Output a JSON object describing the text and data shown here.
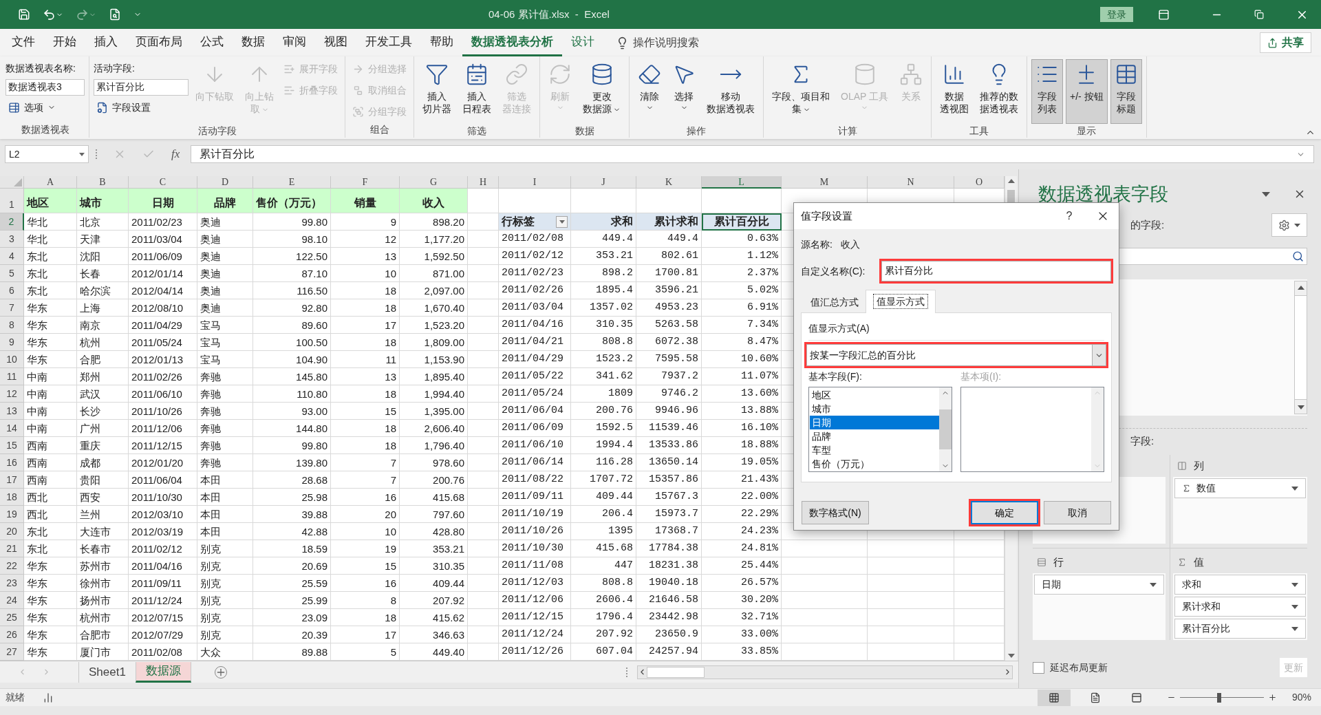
{
  "title_bar": {
    "title": "04-06 累计值.xlsx  -  Excel",
    "sign_in": "登录"
  },
  "menu_tabs": [
    {
      "label": "文件",
      "selected": false,
      "contextual": false
    },
    {
      "label": "开始",
      "selected": false,
      "contextual": false
    },
    {
      "label": "插入",
      "selected": false,
      "contextual": false
    },
    {
      "label": "页面布局",
      "selected": false,
      "contextual": false
    },
    {
      "label": "公式",
      "selected": false,
      "contextual": false
    },
    {
      "label": "数据",
      "selected": false,
      "contextual": false
    },
    {
      "label": "审阅",
      "selected": false,
      "contextual": false
    },
    {
      "label": "视图",
      "selected": false,
      "contextual": false
    },
    {
      "label": "开发工具",
      "selected": false,
      "contextual": false
    },
    {
      "label": "帮助",
      "selected": false,
      "contextual": false
    },
    {
      "label": "数据透视表分析",
      "selected": true,
      "contextual": true
    },
    {
      "label": "设计",
      "selected": false,
      "contextual": true
    }
  ],
  "tell_me": "操作说明搜索",
  "share": "共享",
  "ribbon": [
    {
      "label": "数据透视表",
      "items": [
        {
          "kind": "caption",
          "label": "数据透视表名称:"
        },
        {
          "kind": "field",
          "value": "数据透视表3"
        },
        {
          "kind": "small",
          "label": "选项",
          "dropdown": true,
          "disabled": false
        }
      ]
    },
    {
      "label": "活动字段",
      "items": [
        {
          "kind": "caption",
          "label": "活动字段:"
        },
        {
          "kind": "field",
          "value": "累计百分比"
        },
        {
          "kind": "small",
          "label": "字段设置",
          "dropdown": false,
          "disabled": false
        },
        {
          "kind": "large",
          "lines": [
            "向下钻取"
          ],
          "dropdown": false,
          "disabled": true
        },
        {
          "kind": "large",
          "lines": [
            "向上钻",
            "取"
          ],
          "dropdown": true,
          "disabled": true
        },
        {
          "kind": "small",
          "label": "展开字段",
          "dropdown": false,
          "disabled": true
        },
        {
          "kind": "small",
          "label": "折叠字段",
          "dropdown": false,
          "disabled": true
        }
      ]
    },
    {
      "label": "组合",
      "items": [
        {
          "kind": "small",
          "label": "分组选择",
          "dropdown": false,
          "disabled": true
        },
        {
          "kind": "small",
          "label": "取消组合",
          "dropdown": false,
          "disabled": true
        },
        {
          "kind": "small",
          "label": "分组字段",
          "dropdown": false,
          "disabled": true
        }
      ]
    },
    {
      "label": "筛选",
      "items": [
        {
          "kind": "large",
          "lines": [
            "插入",
            "切片器"
          ],
          "dropdown": false,
          "disabled": false
        },
        {
          "kind": "large",
          "lines": [
            "插入",
            "日程表"
          ],
          "dropdown": false,
          "disabled": false
        },
        {
          "kind": "large",
          "lines": [
            "筛选",
            "器连接"
          ],
          "dropdown": false,
          "disabled": true
        }
      ]
    },
    {
      "label": "数据",
      "items": [
        {
          "kind": "large",
          "lines": [
            "刷新"
          ],
          "dropdown": true,
          "disabled": true
        },
        {
          "kind": "large",
          "lines": [
            "更改",
            "数据源"
          ],
          "dropdown": true,
          "disabled": false
        }
      ]
    },
    {
      "label": "操作",
      "items": [
        {
          "kind": "large",
          "lines": [
            "清除"
          ],
          "dropdown": true,
          "disabled": false
        },
        {
          "kind": "large",
          "lines": [
            "选择"
          ],
          "dropdown": true,
          "disabled": false
        },
        {
          "kind": "large",
          "lines": [
            "移动",
            "数据透视表"
          ],
          "dropdown": false,
          "disabled": false
        }
      ]
    },
    {
      "label": "计算",
      "items": [
        {
          "kind": "large",
          "lines": [
            "字段、项目和",
            "集"
          ],
          "dropdown": true,
          "disabled": false
        },
        {
          "kind": "large",
          "lines": [
            "OLAP 工具"
          ],
          "dropdown": true,
          "disabled": true
        },
        {
          "kind": "large",
          "lines": [
            "关系"
          ],
          "dropdown": false,
          "disabled": true
        }
      ]
    },
    {
      "label": "工具",
      "items": [
        {
          "kind": "large",
          "lines": [
            "数据",
            "透视图"
          ],
          "dropdown": false,
          "disabled": false
        },
        {
          "kind": "large",
          "lines": [
            "推荐的数",
            "据透视表"
          ],
          "dropdown": false,
          "disabled": false
        }
      ]
    },
    {
      "label": "显示",
      "items": [
        {
          "kind": "large",
          "lines": [
            "字段",
            "列表"
          ],
          "dropdown": false,
          "disabled": false,
          "pressed": true
        },
        {
          "kind": "large",
          "lines": [
            "+/- 按钮"
          ],
          "dropdown": false,
          "disabled": false,
          "pressed": true
        },
        {
          "kind": "large",
          "lines": [
            "字段",
            "标题"
          ],
          "dropdown": false,
          "disabled": false,
          "pressed": true
        }
      ]
    }
  ],
  "formula_bar": {
    "name_box": "L2",
    "function_label": "fx",
    "content": "累计百分比"
  },
  "columns": [
    {
      "label": "A",
      "selected": false
    },
    {
      "label": "B",
      "selected": false
    },
    {
      "label": "C",
      "selected": false
    },
    {
      "label": "D",
      "selected": false
    },
    {
      "label": "E",
      "selected": false
    },
    {
      "label": "F",
      "selected": false
    },
    {
      "label": "G",
      "selected": false
    },
    {
      "label": "H",
      "selected": false
    },
    {
      "label": "I",
      "selected": false
    },
    {
      "label": "J",
      "selected": false
    },
    {
      "label": "K",
      "selected": false
    },
    {
      "label": "L",
      "selected": true
    },
    {
      "label": "M",
      "selected": false
    },
    {
      "label": "N",
      "selected": false
    },
    {
      "label": "O",
      "selected": false
    }
  ],
  "row_numbers": [
    {
      "label": "1",
      "selected": false
    },
    {
      "label": "2",
      "selected": true
    },
    {
      "label": "3",
      "selected": false
    },
    {
      "label": "4",
      "selected": false
    },
    {
      "label": "5",
      "selected": false
    },
    {
      "label": "6",
      "selected": false
    },
    {
      "label": "7",
      "selected": false
    },
    {
      "label": "8",
      "selected": false
    },
    {
      "label": "9",
      "selected": false
    },
    {
      "label": "10",
      "selected": false
    },
    {
      "label": "11",
      "selected": false
    },
    {
      "label": "12",
      "selected": false
    },
    {
      "label": "13",
      "selected": false
    },
    {
      "label": "14",
      "selected": false
    },
    {
      "label": "15",
      "selected": false
    },
    {
      "label": "16",
      "selected": false
    },
    {
      "label": "17",
      "selected": false
    },
    {
      "label": "18",
      "selected": false
    },
    {
      "label": "19",
      "selected": false
    },
    {
      "label": "20",
      "selected": false
    },
    {
      "label": "21",
      "selected": false
    },
    {
      "label": "22",
      "selected": false
    },
    {
      "label": "23",
      "selected": false
    },
    {
      "label": "24",
      "selected": false
    },
    {
      "label": "25",
      "selected": false
    },
    {
      "label": "26",
      "selected": false
    },
    {
      "label": "27",
      "selected": false
    }
  ],
  "source_table": {
    "header": [
      "地区",
      "城市",
      "日期",
      "品牌",
      "售价（万元）",
      "销量",
      "收入"
    ],
    "rows": [
      [
        "华北",
        "北京",
        "2011/02/23",
        "奥迪",
        "99.80",
        "9",
        "898.20"
      ],
      [
        "华北",
        "天津",
        "2011/03/04",
        "奥迪",
        "98.10",
        "12",
        "1,177.20"
      ],
      [
        "东北",
        "沈阳",
        "2011/06/09",
        "奥迪",
        "122.50",
        "13",
        "1,592.50"
      ],
      [
        "东北",
        "长春",
        "2012/01/14",
        "奥迪",
        "87.10",
        "10",
        "871.00"
      ],
      [
        "东北",
        "哈尔滨",
        "2012/04/14",
        "奥迪",
        "116.50",
        "18",
        "2,097.00"
      ],
      [
        "华东",
        "上海",
        "2012/08/10",
        "奥迪",
        "92.80",
        "18",
        "1,670.40"
      ],
      [
        "华东",
        "南京",
        "2011/04/29",
        "宝马",
        "89.60",
        "17",
        "1,523.20"
      ],
      [
        "华东",
        "杭州",
        "2011/05/24",
        "宝马",
        "100.50",
        "18",
        "1,809.00"
      ],
      [
        "华东",
        "合肥",
        "2012/01/13",
        "宝马",
        "104.90",
        "11",
        "1,153.90"
      ],
      [
        "中南",
        "郑州",
        "2011/02/26",
        "奔驰",
        "145.80",
        "13",
        "1,895.40"
      ],
      [
        "中南",
        "武汉",
        "2011/06/10",
        "奔驰",
        "110.80",
        "18",
        "1,994.40"
      ],
      [
        "中南",
        "长沙",
        "2011/10/26",
        "奔驰",
        "93.00",
        "15",
        "1,395.00"
      ],
      [
        "中南",
        "广州",
        "2011/12/06",
        "奔驰",
        "144.80",
        "18",
        "2,606.40"
      ],
      [
        "西南",
        "重庆",
        "2011/12/15",
        "奔驰",
        "99.80",
        "18",
        "1,796.40"
      ],
      [
        "西南",
        "成都",
        "2012/01/20",
        "奔驰",
        "139.80",
        "7",
        "978.60"
      ],
      [
        "西南",
        "贵阳",
        "2011/06/04",
        "本田",
        "28.68",
        "7",
        "200.76"
      ],
      [
        "西北",
        "西安",
        "2011/10/30",
        "本田",
        "25.98",
        "16",
        "415.68"
      ],
      [
        "西北",
        "兰州",
        "2012/03/10",
        "本田",
        "39.88",
        "20",
        "797.60"
      ],
      [
        "东北",
        "大连市",
        "2012/03/19",
        "本田",
        "42.88",
        "10",
        "428.80"
      ],
      [
        "东北",
        "长春市",
        "2011/02/12",
        "别克",
        "18.59",
        "19",
        "353.21"
      ],
      [
        "华东",
        "苏州市",
        "2011/04/16",
        "别克",
        "20.69",
        "15",
        "310.35"
      ],
      [
        "华东",
        "徐州市",
        "2011/09/11",
        "别克",
        "25.59",
        "16",
        "409.44"
      ],
      [
        "华东",
        "扬州市",
        "2011/12/24",
        "别克",
        "25.99",
        "8",
        "207.92"
      ],
      [
        "华东",
        "杭州市",
        "2012/07/15",
        "别克",
        "23.09",
        "18",
        "415.62"
      ],
      [
        "华东",
        "合肥市",
        "2012/07/29",
        "别克",
        "20.39",
        "17",
        "346.63"
      ],
      [
        "华东",
        "厦门市",
        "2011/02/08",
        "大众",
        "89.88",
        "5",
        "449.40"
      ]
    ]
  },
  "pivot_table": {
    "header": [
      "行标签",
      "求和",
      "累计求和",
      "累计百分比"
    ],
    "rows": [
      [
        "2011/02/08",
        "449.4",
        "449.4",
        "0.63%"
      ],
      [
        "2011/02/12",
        "353.21",
        "802.61",
        "1.12%"
      ],
      [
        "2011/02/23",
        "898.2",
        "1700.81",
        "2.37%"
      ],
      [
        "2011/02/26",
        "1895.4",
        "3596.21",
        "5.02%"
      ],
      [
        "2011/03/04",
        "1357.02",
        "4953.23",
        "6.91%"
      ],
      [
        "2011/04/16",
        "310.35",
        "5263.58",
        "7.34%"
      ],
      [
        "2011/04/21",
        "808.8",
        "6072.38",
        "8.47%"
      ],
      [
        "2011/04/29",
        "1523.2",
        "7595.58",
        "10.60%"
      ],
      [
        "2011/05/22",
        "341.62",
        "7937.2",
        "11.07%"
      ],
      [
        "2011/05/24",
        "1809",
        "9746.2",
        "13.60%"
      ],
      [
        "2011/06/04",
        "200.76",
        "9946.96",
        "13.88%"
      ],
      [
        "2011/06/09",
        "1592.5",
        "11539.46",
        "16.10%"
      ],
      [
        "2011/06/10",
        "1994.4",
        "13533.86",
        "18.88%"
      ],
      [
        "2011/06/14",
        "116.28",
        "13650.14",
        "19.05%"
      ],
      [
        "2011/08/22",
        "1707.72",
        "15357.86",
        "21.43%"
      ],
      [
        "2011/09/11",
        "409.44",
        "15767.3",
        "22.00%"
      ],
      [
        "2011/10/19",
        "206.4",
        "15973.7",
        "22.29%"
      ],
      [
        "2011/10/26",
        "1395",
        "17368.7",
        "24.23%"
      ],
      [
        "2011/10/30",
        "415.68",
        "17784.38",
        "24.81%"
      ],
      [
        "2011/11/08",
        "447",
        "18231.38",
        "25.44%"
      ],
      [
        "2011/12/03",
        "808.8",
        "19040.18",
        "26.57%"
      ],
      [
        "2011/12/06",
        "2606.4",
        "21646.58",
        "30.20%"
      ],
      [
        "2011/12/15",
        "1796.4",
        "23442.98",
        "32.71%"
      ],
      [
        "2011/12/24",
        "207.92",
        "23650.9",
        "33.00%"
      ],
      [
        "2011/12/26",
        "607.04",
        "24257.94",
        "33.85%"
      ]
    ]
  },
  "sheet_tabs": [
    {
      "label": "Sheet1",
      "selected": false
    },
    {
      "label": "数据源",
      "selected": true
    }
  ],
  "status_bar": {
    "status": "就绪",
    "view_buttons": [
      {
        "selected": true
      },
      {
        "selected": false
      },
      {
        "selected": false
      }
    ],
    "zoom": {
      "level": 0.47,
      "reading": "90%"
    }
  },
  "field_pane": {
    "title": "数据透视表字段",
    "choose_fields_partial": "的字段:",
    "drag_fields_partial": "字段:",
    "areas": [
      {
        "kind": "columns",
        "label": "列",
        "items": [
          "数值"
        ]
      },
      {
        "kind": "rows",
        "label": "行",
        "items": [
          "日期"
        ]
      },
      {
        "kind": "values",
        "label": "值",
        "items": [
          "求和",
          "累计求和",
          "累计百分比"
        ]
      }
    ],
    "defer_update": {
      "label": "延迟布局更新",
      "checked": false
    },
    "update_button": {
      "label": "更新",
      "disabled": true
    }
  },
  "dialog": {
    "title": "值字段设置",
    "help": "?",
    "source_label": "源名称:",
    "source_value": "收入",
    "custom_name_label": "自定义名称(C):",
    "custom_name": "累计百分比",
    "custom_name_highlighted": true,
    "tabs": [
      {
        "label": "值汇总方式",
        "selected": false
      },
      {
        "label": "值显示方式",
        "selected": true
      }
    ],
    "show_as_label": "值显示方式(A)",
    "show_as_value": "按某一字段汇总的百分比",
    "show_as_highlighted": true,
    "base_field_label": "基本字段(F):",
    "base_fields": [
      {
        "label": "地区",
        "selected": false
      },
      {
        "label": "城市",
        "selected": false
      },
      {
        "label": "日期",
        "selected": true
      },
      {
        "label": "品牌",
        "selected": false
      },
      {
        "label": "车型",
        "selected": false
      },
      {
        "label": "售价（万元）",
        "selected": false
      }
    ],
    "base_item_label": "基本项(I):",
    "base_item_disabled": true,
    "buttons": [
      {
        "label": "数字格式(N)",
        "kind": "secondary",
        "highlighted": false
      },
      {
        "label": "确定",
        "kind": "default",
        "highlighted": true
      },
      {
        "label": "取消",
        "kind": "secondary",
        "highlighted": false
      }
    ]
  }
}
